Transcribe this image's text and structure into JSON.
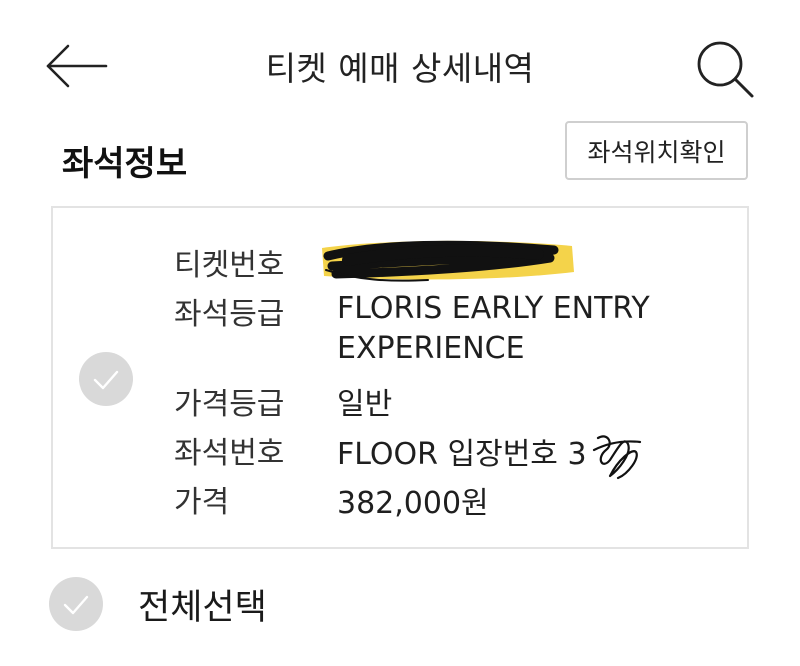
{
  "header": {
    "title": "티켓 예매 상세내역",
    "back_icon": "arrow-left-icon",
    "search_icon": "search-icon"
  },
  "seat_info": {
    "section_title": "좌석정보",
    "seat_location_button": "좌석위치확인",
    "rows": [
      {
        "label": "티켓번호",
        "value": ""
      },
      {
        "label": "좌석등급",
        "value_line1": "FLORIS EARLY ENTRY",
        "value_line2": "EXPERIENCE"
      },
      {
        "label": "가격등급",
        "value": "일반"
      },
      {
        "label": "좌석번호",
        "value": "FLOOR 입장번호 3"
      },
      {
        "label": "가격",
        "value": "382,000원"
      }
    ]
  },
  "select_all": {
    "label": "전체선택",
    "icon": "check-icon"
  },
  "colors": {
    "check_bg": "#d9d9d9",
    "highlight": "#f4d34a",
    "border": "#e3e3e3"
  }
}
